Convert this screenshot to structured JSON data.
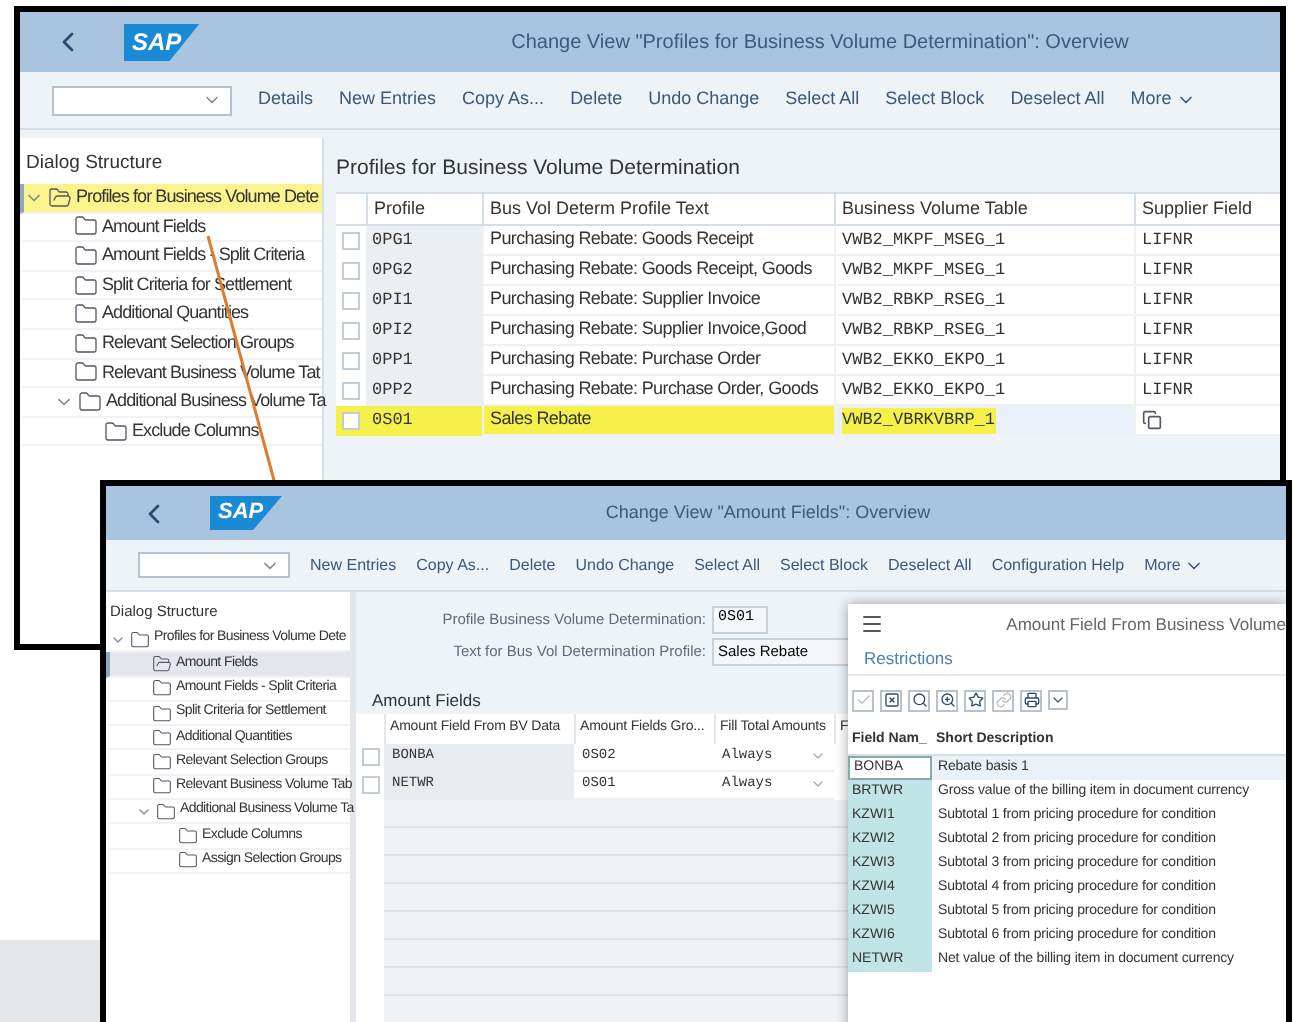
{
  "back_window": {
    "logo": "SAP",
    "title": "Change View \"Profiles for Business Volume Determination\": Overview",
    "toolbar": [
      "Details",
      "New Entries",
      "Copy As...",
      "Delete",
      "Undo Change",
      "Select All",
      "Select Block",
      "Deselect All"
    ],
    "more": "More",
    "dialog_structure": {
      "title": "Dialog Structure",
      "tree": [
        {
          "label": "Profiles for Business Volume Dete",
          "kind": "root",
          "expanded": true,
          "selected": true,
          "highlighted": true,
          "children": [
            {
              "label": "Amount Fields",
              "kind": "folder",
              "selected": false,
              "highlighted": false
            },
            {
              "label": "Amount Fields - Split Criteria",
              "kind": "folder",
              "selected": false,
              "highlighted": false
            },
            {
              "label": "Split Criteria for Settlement",
              "kind": "folder",
              "selected": false,
              "highlighted": false
            },
            {
              "label": "Additional Quantities",
              "kind": "folder",
              "selected": false,
              "highlighted": false
            },
            {
              "label": "Relevant Selection Groups",
              "kind": "folder",
              "selected": false,
              "highlighted": false
            },
            {
              "label": "Relevant Business Volume Tat",
              "kind": "folder",
              "selected": false,
              "highlighted": false
            },
            {
              "label": "Additional Business Volume Ta",
              "kind": "folder",
              "expanded": true,
              "selected": false,
              "highlighted": false,
              "children": [
                {
                  "label": "Exclude Columns",
                  "kind": "folder",
                  "selected": false,
                  "highlighted": false
                }
              ]
            }
          ]
        }
      ]
    },
    "table": {
      "title": "Profiles for Business Volume Determination",
      "columns": [
        "Profile",
        "Bus Vol Determ Profile Text",
        "Business Volume Table",
        "Supplier Field"
      ],
      "rows": [
        {
          "profile": "0PG1",
          "text": "Purchasing Rebate: Goods Receipt",
          "table": "VWB2_MKPF_MSEG_1",
          "supplier": "LIFNR",
          "checked": false,
          "highlighted": false
        },
        {
          "profile": "0PG2",
          "text": "Purchasing Rebate: Goods Receipt, Goods",
          "table": "VWB2_MKPF_MSEG_1",
          "supplier": "LIFNR",
          "checked": false,
          "highlighted": false
        },
        {
          "profile": "0PI1",
          "text": "Purchasing Rebate: Supplier Invoice",
          "table": "VWB2_RBKP_RSEG_1",
          "supplier": "LIFNR",
          "checked": false,
          "highlighted": false
        },
        {
          "profile": "0PI2",
          "text": "Purchasing Rebate: Supplier Invoice,Good",
          "table": "VWB2_RBKP_RSEG_1",
          "supplier": "LIFNR",
          "checked": false,
          "highlighted": false
        },
        {
          "profile": "0PP1",
          "text": "Purchasing Rebate: Purchase Order",
          "table": "VWB2_EKKO_EKPO_1",
          "supplier": "LIFNR",
          "checked": false,
          "highlighted": false
        },
        {
          "profile": "0PP2",
          "text": "Purchasing Rebate: Purchase Order, Goods",
          "table": "VWB2_EKKO_EKPO_1",
          "supplier": "LIFNR",
          "checked": false,
          "highlighted": false
        },
        {
          "profile": "0S01",
          "text": "Sales Rebate",
          "table": "VWB2_VBRKVBRP_1",
          "checked": false,
          "highlighted": true
        }
      ]
    }
  },
  "front_window": {
    "logo": "SAP",
    "title": "Change View \"Amount Fields\": Overview",
    "toolbar": [
      "New Entries",
      "Copy As...",
      "Delete",
      "Undo Change",
      "Select All",
      "Select Block",
      "Deselect All",
      "Configuration Help"
    ],
    "more": "More",
    "dialog_structure": {
      "title": "Dialog Structure",
      "tree": [
        {
          "label": "Profiles for Business Volume Dete",
          "kind": "folder",
          "expanded": true,
          "selected": false,
          "highlighted": false,
          "children": [
            {
              "label": "Amount Fields",
              "kind": "root",
              "selected": true,
              "highlighted": false
            },
            {
              "label": "Amount Fields - Split Criteria",
              "kind": "folder",
              "selected": false,
              "highlighted": false
            },
            {
              "label": "Split Criteria for Settlement",
              "kind": "folder",
              "selected": false,
              "highlighted": false
            },
            {
              "label": "Additional Quantities",
              "kind": "folder",
              "selected": false,
              "highlighted": false
            },
            {
              "label": "Relevant Selection Groups",
              "kind": "folder",
              "selected": false,
              "highlighted": false
            },
            {
              "label": "Relevant Business Volume Tab",
              "kind": "folder",
              "selected": false,
              "highlighted": false
            },
            {
              "label": "Additional Business Volume Ta",
              "kind": "folder",
              "expanded": true,
              "selected": false,
              "highlighted": false,
              "children": [
                {
                  "label": "Exclude Columns",
                  "kind": "folder",
                  "selected": false,
                  "highlighted": false
                },
                {
                  "label": "Assign Selection Groups",
                  "kind": "folder",
                  "selected": false,
                  "highlighted": false
                }
              ]
            }
          ]
        }
      ]
    },
    "form": [
      {
        "label": "Profile Business Volume Determination:",
        "value": "0S01"
      },
      {
        "label": "Text for Bus Vol Determination Profile:",
        "value": "Sales Rebate"
      }
    ],
    "table": {
      "title": "Amount Fields",
      "columns": [
        "Amount Field From BV Data",
        "Amount Fields Gro...",
        "Fill Total Amounts",
        "F"
      ],
      "rows": [
        {
          "field": "BONBA",
          "group": "0S02",
          "fill": "Always",
          "checked": false
        },
        {
          "field": "NETWR",
          "group": "0S01",
          "fill": "Always",
          "checked": false
        }
      ]
    },
    "popup": {
      "title": "Amount Field From Business Volume",
      "link": "Restrictions",
      "columns": [
        "Field Nam_",
        "Short Description"
      ],
      "rows": [
        {
          "field": "BONBA",
          "description": "Rebate basis 1",
          "selected": true
        },
        {
          "field": "BRTWR",
          "description": "Gross value of the billing item in document currency",
          "selected": false
        },
        {
          "field": "KZWI1",
          "description": "Subtotal 1 from pricing procedure for condition",
          "selected": false
        },
        {
          "field": "KZWI2",
          "description": "Subtotal 2 from pricing procedure for condition",
          "selected": false
        },
        {
          "field": "KZWI3",
          "description": "Subtotal 3 from pricing procedure for condition",
          "selected": false
        },
        {
          "field": "KZWI4",
          "description": "Subtotal 4 from pricing procedure for condition",
          "selected": false
        },
        {
          "field": "KZWI5",
          "description": "Subtotal 5 from pricing procedure for condition",
          "selected": false
        },
        {
          "field": "KZWI6",
          "description": "Subtotal 6 from pricing procedure for condition",
          "selected": false
        },
        {
          "field": "NETWR",
          "description": "Net value of the billing item in document currency",
          "selected": false
        }
      ]
    }
  }
}
